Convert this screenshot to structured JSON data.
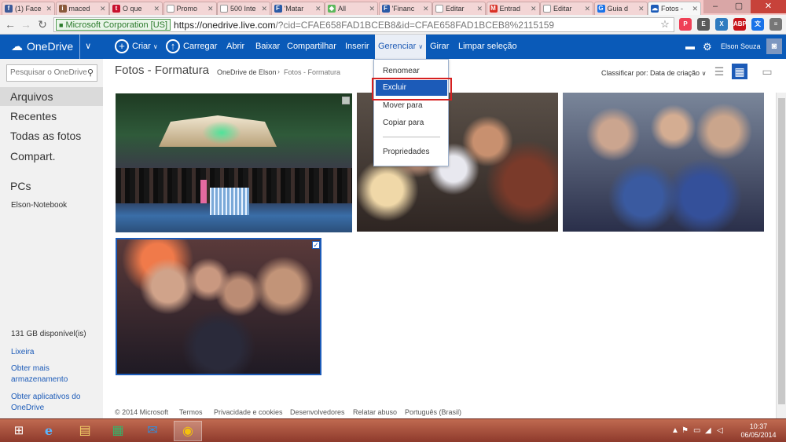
{
  "browser": {
    "tabs": [
      {
        "label": "(1) Face",
        "favicon": "facebook-icon",
        "color": "#3b5998",
        "glyph": "f"
      },
      {
        "label": "maced",
        "favicon": "instagram-icon",
        "color": "#8a5a3c",
        "glyph": "i"
      },
      {
        "label": "O que",
        "favicon": "techtudo-icon",
        "color": "#c8102e",
        "glyph": "t"
      },
      {
        "label": "Promo",
        "favicon": "page-icon",
        "color": "#ffffff",
        "glyph": ""
      },
      {
        "label": "500 Inte",
        "favicon": "page-icon",
        "color": "#ffffff",
        "glyph": ""
      },
      {
        "label": "'Matar",
        "favicon": "f-icon",
        "color": "#2a5aa6",
        "glyph": "F"
      },
      {
        "label": "All",
        "favicon": "android-icon",
        "color": "#5cb85c",
        "glyph": "◆"
      },
      {
        "label": "'Financ",
        "favicon": "f-icon",
        "color": "#2a5aa6",
        "glyph": "F"
      },
      {
        "label": "Editar",
        "favicon": "page-icon",
        "color": "#ffffff",
        "glyph": ""
      },
      {
        "label": "Entrad",
        "favicon": "gmail-icon",
        "color": "#d93025",
        "glyph": "M"
      },
      {
        "label": "Editar",
        "favicon": "page-icon",
        "color": "#ffffff",
        "glyph": ""
      },
      {
        "label": "Guia d",
        "favicon": "guia-icon",
        "color": "#1a73e8",
        "glyph": "G"
      },
      {
        "label": "Fotos -",
        "favicon": "onedrive-icon",
        "color": "#1c5bb8",
        "glyph": "☁",
        "active": true
      }
    ],
    "ev_label": "Microsoft Corporation [US]",
    "url_host": "https://onedrive.live.com",
    "url_rest": "/?cid=CFAE658FAD1BCEB8&id=CFAE658FAD1BCEB8%2115159",
    "extensions": [
      {
        "name": "pocket-icon",
        "color": "#ef4056",
        "glyph": "P"
      },
      {
        "name": "evernote-icon",
        "color": "#5a5a5a",
        "glyph": "E"
      },
      {
        "name": "xmarks-icon",
        "color": "#2f7bbf",
        "glyph": "X"
      },
      {
        "name": "abp-icon",
        "color": "#c7141a",
        "glyph": "ABP"
      },
      {
        "name": "translate-icon",
        "color": "#1a73e8",
        "glyph": "文"
      },
      {
        "name": "chrome-menu-icon",
        "color": "#777777",
        "glyph": "≡"
      }
    ]
  },
  "onedrive": {
    "brand": "OneDrive",
    "toolbar": {
      "criar": "Criar",
      "carregar": "Carregar",
      "abrir": "Abrir",
      "baixar": "Baixar",
      "compartilhar": "Compartilhar",
      "inserir": "Inserir",
      "gerenciar": "Gerenciar",
      "girar": "Girar",
      "limpar": "Limpar seleção"
    },
    "user": "Elson Souza",
    "search_placeholder": "Pesquisar o OneDrive",
    "nav": [
      "Arquivos",
      "Recentes",
      "Todas as fotos",
      "Compart."
    ],
    "pcs_header": "PCs",
    "pc_name": "Elson-Notebook",
    "storage": "131 GB disponível(is)",
    "lixeira": "Lixeira",
    "obter_mais": "Obter mais armazenamento",
    "obter_apps": "Obter aplicativos do OneDrive"
  },
  "folder": {
    "title": "Fotos - Formatura",
    "breadcrumb_root": "OneDrive de Elson",
    "breadcrumb_sep": "›",
    "breadcrumb_current": "Fotos - Formatura",
    "sort_label": "Classificar por: Data de criação",
    "photos": [
      {
        "name": "photo-party-pool",
        "selected": false
      },
      {
        "name": "photo-group-blurred-1",
        "selected": false
      },
      {
        "name": "photo-group-blurred-2",
        "selected": false
      },
      {
        "name": "photo-group-blurred-3",
        "selected": true
      }
    ]
  },
  "menu": {
    "renomear": "Renomear",
    "excluir": "Excluir",
    "mover": "Mover para",
    "copiar": "Copiar para",
    "propriedades": "Propriedades"
  },
  "footer": {
    "copyright": "© 2014 Microsoft",
    "termos": "Termos",
    "privacidade": "Privacidade e cookies",
    "desenvolvedores": "Desenvolvedores",
    "relatar": "Relatar abuso",
    "idioma": "Português (Brasil)"
  },
  "taskbar": {
    "time": "10:37",
    "date": "06/05/2014"
  },
  "colors": {
    "onedrive_blue": "#0a5ab8",
    "selection_blue": "#1c5bb8",
    "highlight_red": "#d62020"
  }
}
